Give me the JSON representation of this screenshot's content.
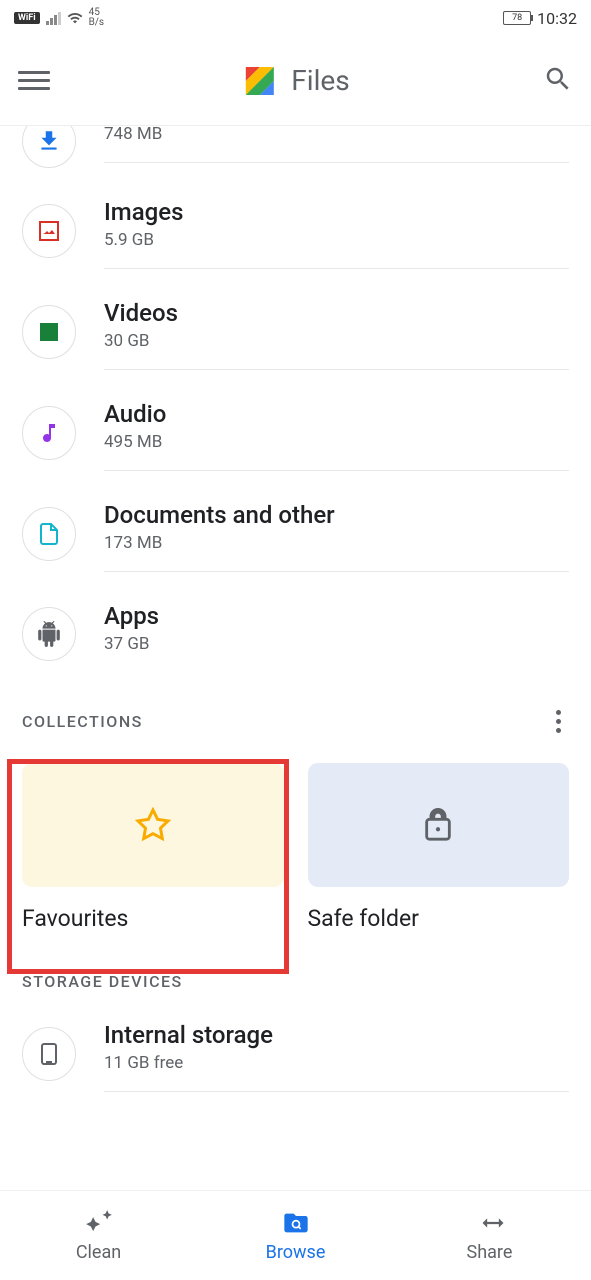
{
  "status": {
    "data_rate_top": "45",
    "data_rate_bottom": "B/s",
    "battery": "78",
    "time": "10:32"
  },
  "app": {
    "name": "Files"
  },
  "categories": [
    {
      "title": "",
      "sub": "748 MB",
      "icon": "download",
      "color": "#1a73e8"
    },
    {
      "title": "Images",
      "sub": "5.9 GB",
      "icon": "image",
      "color": "#d93025"
    },
    {
      "title": "Videos",
      "sub": "30 GB",
      "icon": "video",
      "color": "#188038"
    },
    {
      "title": "Audio",
      "sub": "495 MB",
      "icon": "audio",
      "color": "#9334e6"
    },
    {
      "title": "Documents and other",
      "sub": "173 MB",
      "icon": "document",
      "color": "#12b5cb"
    },
    {
      "title": "Apps",
      "sub": "37 GB",
      "icon": "apps",
      "color": "#5f6368"
    }
  ],
  "sections": {
    "collections": "COLLECTIONS",
    "storage": "STORAGE DEVICES"
  },
  "collections": [
    {
      "label": "Favourites",
      "card_color": "yellow"
    },
    {
      "label": "Safe folder",
      "card_color": "blue"
    }
  ],
  "storage": [
    {
      "title": "Internal storage",
      "sub": "11 GB free"
    }
  ],
  "nav": [
    {
      "label": "Clean",
      "active": false
    },
    {
      "label": "Browse",
      "active": true
    },
    {
      "label": "Share",
      "active": false
    }
  ]
}
